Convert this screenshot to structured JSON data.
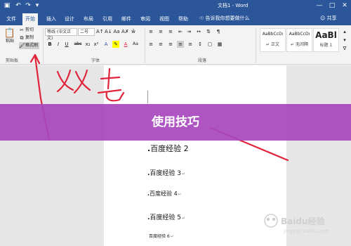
{
  "titlebar": {
    "doc_title": "文档1 - Word",
    "qat_icons": [
      "save-icon",
      "undo-icon",
      "redo-icon",
      "customize-icon"
    ]
  },
  "tabs": [
    "文件",
    "开始",
    "插入",
    "设计",
    "布局",
    "引用",
    "邮件",
    "审阅",
    "视图",
    "帮助"
  ],
  "active_tab": "开始",
  "tell_me": "告诉我你想要做什么",
  "share": "共享",
  "clipboard": {
    "paste": "粘贴",
    "cut": "剪切",
    "copy": "复制",
    "format_painter": "格式刷",
    "label": "剪贴板"
  },
  "font": {
    "name": "等线 (中文正文)",
    "size": "二号",
    "label": "字体",
    "buttons": [
      "B",
      "I",
      "U",
      "abc",
      "x₂",
      "x²",
      "A",
      "A",
      "Aa"
    ]
  },
  "paragraph": {
    "label": "段落"
  },
  "styles": [
    {
      "sample": "AaBbCcDı",
      "name": "↵ 正文"
    },
    {
      "sample": "AaBbCcDı",
      "name": "↵ 无间隔"
    },
    {
      "sample": "AaBl",
      "name": "标题 1"
    }
  ],
  "document": {
    "lines": [
      {
        "text": "百度经验 2",
        "mark": ""
      },
      {
        "text": "百度经验 3",
        "mark": "↵"
      },
      {
        "text": "百度经验 4",
        "mark": "↵"
      },
      {
        "text": "百度经验 5",
        "mark": "↵"
      },
      {
        "text": "百度经验 6",
        "mark": "↵"
      }
    ]
  },
  "banner": {
    "title": "使用技巧"
  },
  "watermark": {
    "text": "Baidu经验",
    "url": "jingyan.baidu.com"
  },
  "colors": {
    "word_blue": "#2b579a",
    "banner": "#a846be",
    "annotation_red": "#e0243a"
  }
}
